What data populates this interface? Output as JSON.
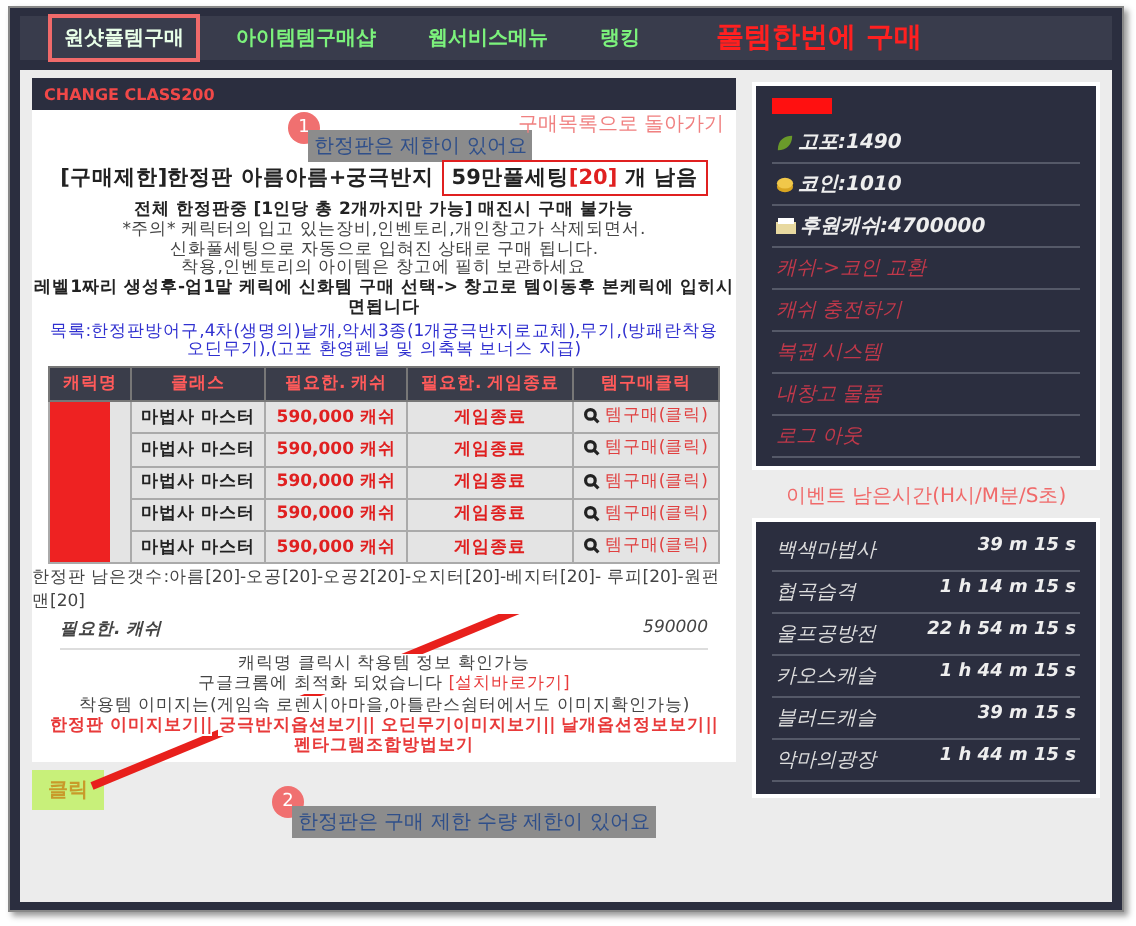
{
  "nav": {
    "items": [
      {
        "label": "원샷풀템구매",
        "selected": true
      },
      {
        "label": "아이템템구매샵",
        "selected": false
      },
      {
        "label": "웹서비스메뉴",
        "selected": false
      },
      {
        "label": "랭킹",
        "selected": false
      }
    ],
    "annotation": "풀템한번에 구매"
  },
  "product": {
    "header": "CHANGE CLASS200",
    "title": "[구매제한]한정판 아름아름+궁극반지",
    "title_highlight": "59만풀세팅",
    "count": "[20]",
    "title_suffix": "개 남음",
    "notes": [
      {
        "text": "전체 한정판중 [1인당 총 2개까지만 가능] 매진시 구매 불가능",
        "bold": true
      },
      {
        "text": "*주의* 케릭터의 입고 있는장비,인벤토리,개인창고가 삭제되면서.",
        "bold": false
      },
      {
        "text": "신화풀세팅으로 자동으로 입혀진 상태로 구매 됩니다.",
        "bold": false
      },
      {
        "text": "착용,인벤토리의 아이템은 창고에 필히 보관하세요",
        "bold": false
      },
      {
        "text": "레벨1짜리 생성후-업1말 케릭에 신화템 구매 선택-> 창고로 템이동후 본케릭에 입히시면됩니다",
        "bold": true
      }
    ],
    "contents": "목록:한정판방어구,4차(생명의)날개,악세3종(1개궁극반지로교체),무기,(방패란착용오딘무기),(고포 환영펜닐 및 의축복 보너스 지급)",
    "table": {
      "columns": [
        "캐릭명",
        "클래스",
        "필요한. 캐쉬",
        "필요한. 게임종료",
        "템구매클릭"
      ],
      "rows": [
        {
          "class": "마법사 마스터",
          "cost": "590,000 캐쉬",
          "condition": "게임종료",
          "action": "템구매(클릭)"
        },
        {
          "class": "마법사 마스터",
          "cost": "590,000 캐쉬",
          "condition": "게임종료",
          "action": "템구매(클릭)"
        },
        {
          "class": "마법사 마스터",
          "cost": "590,000 캐쉬",
          "condition": "게임종료",
          "action": "템구매(클릭)"
        },
        {
          "class": "마법사 마스터",
          "cost": "590,000 캐쉬",
          "condition": "게임종료",
          "action": "템구매(클릭)"
        },
        {
          "class": "마법사 마스터",
          "cost": "590,000 캐쉬",
          "condition": "게임종료",
          "action": "템구매(클릭)"
        }
      ]
    },
    "remaining": "한정판 남은갯수:아름[20]-오공[20]-오공2[20]-오지터[20]-베지터[20]- 루피[20]-원펀맨[20]",
    "cost_label": "필요한. 캐쉬",
    "cost_value": "590000",
    "footer": {
      "lines": [
        "캐릭명 클릭시 착용템 정보 확인가능"
      ],
      "chrome_text": "구글크롬에 최적화 되었습니다",
      "chrome_link": "[설치바로가기]",
      "image_note": "착용템 이미지는(게임속 로렌시아마을,아틀란스쉼터에서도 이미지확인가능)",
      "links": [
        "한정판 이미지보기||",
        "궁극반지옵션보기||",
        "오딘무기이미지보기||",
        "날개옵션정보보기||",
        "펜타그램조합방법보기"
      ]
    }
  },
  "annotations": {
    "step1": {
      "number": "1",
      "label": "한정판은 제한이 있어요"
    },
    "back_link": "구매목록으로 돌아가기",
    "click_label": "클릭",
    "step2": {
      "number": "2",
      "label": "한정판은 구매 제한 수량 제한이 있어요"
    }
  },
  "sidebar": {
    "stats": [
      {
        "kind": "leaf",
        "text": "고포:1490"
      },
      {
        "kind": "coin",
        "text": "코인:1010"
      },
      {
        "kind": "cash",
        "text": "후원캐쉬:4700000"
      }
    ],
    "links": [
      "캐쉬->코인 교환",
      "캐쉬 충전하기",
      "복권 시스템",
      "내창고 물품",
      "로그 아웃"
    ],
    "event_title": "이벤트 남은시간(H시/M분/S초)",
    "events": [
      {
        "name": "백색마법사",
        "time": "39 m 15 s"
      },
      {
        "name": "협곡습격",
        "time": "1 h 14 m 15 s"
      },
      {
        "name": "울프공방전",
        "time": "22 h 54 m 15 s"
      },
      {
        "name": "카오스캐슬",
        "time": "1 h 44 m 15 s"
      },
      {
        "name": "블러드캐슬",
        "time": "39 m 15 s"
      },
      {
        "name": "악마의광장",
        "time": "1 h 44 m 15 s"
      }
    ]
  }
}
